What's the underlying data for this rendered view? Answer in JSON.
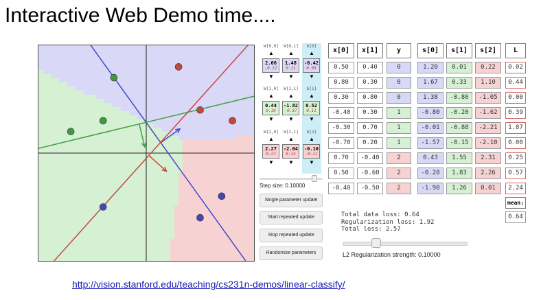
{
  "slide": {
    "title": "Interactive Web Demo time....",
    "link": "http://vision.stanford.edu/teaching/cs231n-demos/linear-classify/"
  },
  "colors": {
    "class0": "#d9d9f7",
    "class1": "#d5f0d2",
    "class2": "#f6d2d2",
    "bias_col": "#cdeef6",
    "line0": "#4646c8",
    "line1": "#3fa03f",
    "line2": "#c8463c"
  },
  "weights": {
    "headers": [
      [
        "W[0,0]",
        "W[0,1]",
        "b[0]"
      ],
      [
        "W[1,0]",
        "W[1,1]",
        "b[1]"
      ],
      [
        "W[2,0]",
        "W[2,1]",
        "b[2]"
      ]
    ],
    "values": [
      [
        "2.06",
        "1.48",
        "-0.42"
      ],
      [
        "0.44",
        "-1.82",
        "0.52"
      ],
      [
        "2.27",
        "-2.04",
        "-0.10"
      ]
    ],
    "grads": [
      [
        "-0.12",
        "0.11",
        "0.00"
      ],
      [
        "0.19",
        "-0.37",
        "0.11"
      ],
      [
        "0.27",
        "0.14",
        "-0.11"
      ]
    ],
    "up_arrow": "▲",
    "down_arrow": "▼"
  },
  "controls": {
    "step_size_label": "Step size: 0.10000",
    "step_size_fraction": 0.9,
    "buttons": [
      "Single parameter update",
      "Start repeated update",
      "Stop repeated update",
      "Randomize parameters"
    ]
  },
  "table": {
    "headers": [
      "x[0]",
      "x[1]",
      "y",
      "s[0]",
      "s[1]",
      "s[2]",
      "L"
    ],
    "rows": [
      {
        "x0": "0.50",
        "x1": "0.40",
        "y": "0",
        "s0": "1.20",
        "s1": "0.01",
        "s2": "0.22",
        "L": "0.02",
        "cls": 0
      },
      {
        "x0": "0.80",
        "x1": "0.30",
        "y": "0",
        "s0": "1.67",
        "s1": "0.33",
        "s2": "1.10",
        "L": "0.44",
        "cls": 0
      },
      {
        "x0": "0.30",
        "x1": "0.80",
        "y": "0",
        "s0": "1.38",
        "s1": "-0.80",
        "s2": "-1.05",
        "L": "0.00",
        "cls": 0
      },
      {
        "x0": "-0.40",
        "x1": "0.30",
        "y": "1",
        "s0": "-0.80",
        "s1": "-0.20",
        "s2": "-1.62",
        "L": "0.39",
        "cls": 1
      },
      {
        "x0": "-0.30",
        "x1": "0.70",
        "y": "1",
        "s0": "-0.01",
        "s1": "-0.88",
        "s2": "-2.21",
        "L": "1.87",
        "cls": 1
      },
      {
        "x0": "-0.70",
        "x1": "0.20",
        "y": "1",
        "s0": "-1.57",
        "s1": "-0.15",
        "s2": "-2.10",
        "L": "0.00",
        "cls": 1
      },
      {
        "x0": "0.70",
        "x1": "-0.40",
        "y": "2",
        "s0": "0.43",
        "s1": "1.55",
        "s2": "2.31",
        "L": "0.25",
        "cls": 2
      },
      {
        "x0": "0.50",
        "x1": "-0.60",
        "y": "2",
        "s0": "-0.28",
        "s1": "1.83",
        "s2": "2.26",
        "L": "0.57",
        "cls": 2
      },
      {
        "x0": "-0.40",
        "x1": "-0.50",
        "y": "2",
        "s0": "-1.98",
        "s1": "1.26",
        "s2": "0.01",
        "L": "2.24",
        "cls": 2
      }
    ],
    "mean_label": "mean:",
    "mean_value": "0.64"
  },
  "loss": {
    "total_data": "Total data loss: 0.64",
    "regularization": "Regularization loss: 1.92",
    "total": "Total loss: 2.57"
  },
  "regularization": {
    "label": "L2 Regularization strength: 0.10000",
    "fraction": 0.25
  }
}
